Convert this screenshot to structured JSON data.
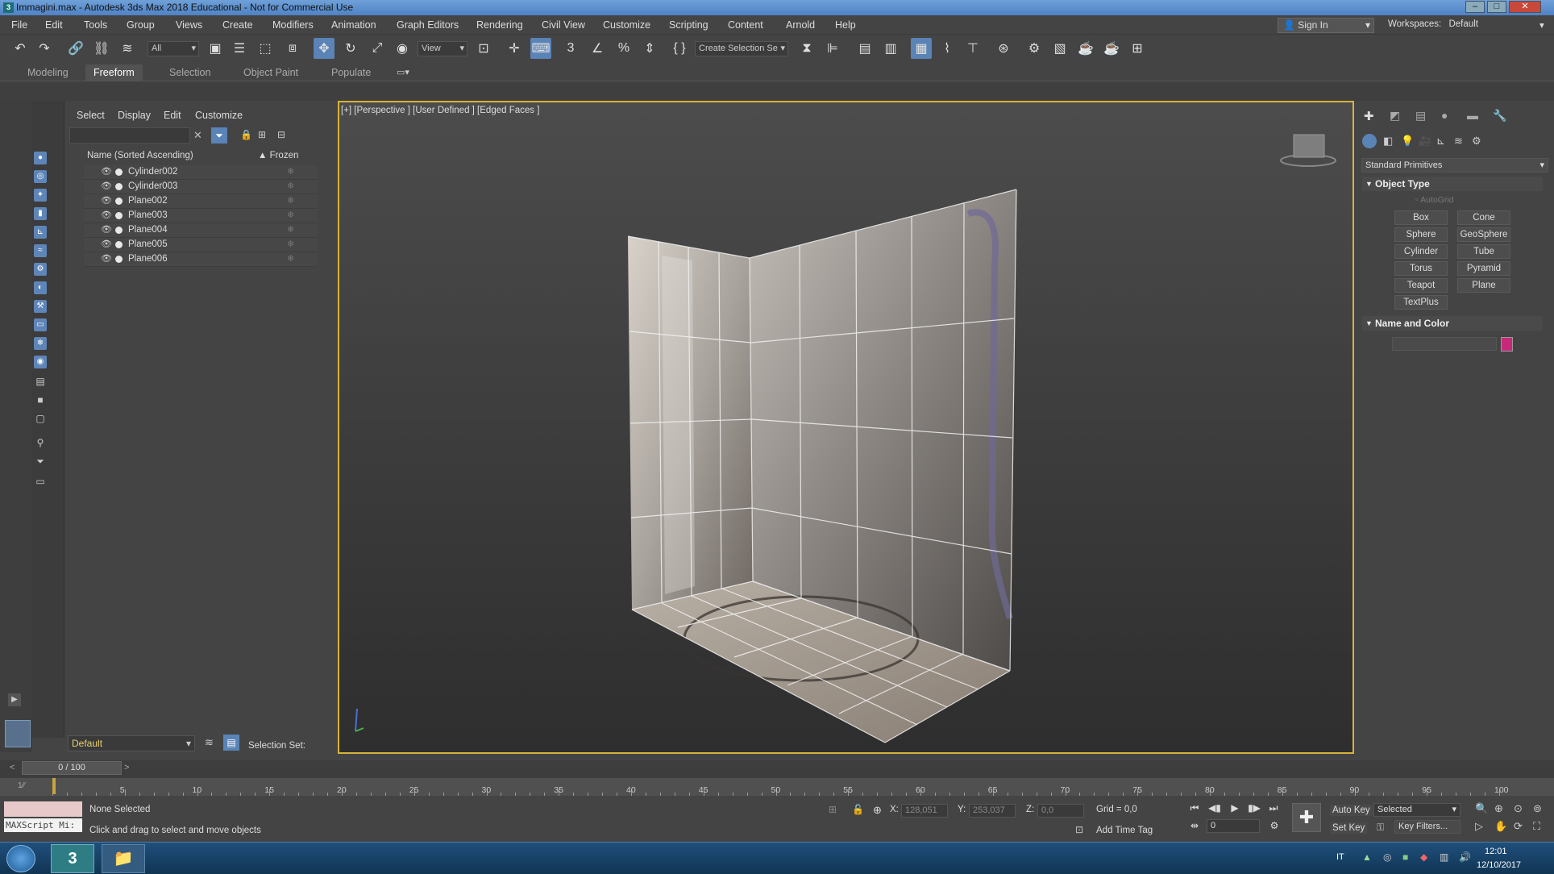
{
  "app": {
    "title": "Immagini.max - Autodesk 3ds Max 2018 Educational - Not for Commercial Use"
  },
  "menu": [
    "File",
    "Edit",
    "Tools",
    "Group",
    "Views",
    "Create",
    "Modifiers",
    "Animation",
    "Graph Editors",
    "Rendering",
    "Civil View",
    "Customize",
    "Scripting",
    "Content",
    "Arnold",
    "Help"
  ],
  "account": {
    "sign_in": "Sign In",
    "workspaces_label": "Workspaces:",
    "workspace": "Default"
  },
  "toolbar": {
    "filter": "All",
    "ref_coord": "View",
    "create_selection_set": "Create Selection Se"
  },
  "ribbon_tabs": [
    "Modeling",
    "Freeform",
    "Selection",
    "Object Paint",
    "Populate"
  ],
  "ribbon_active": "Freeform",
  "scene_explorer": {
    "menu": [
      "Select",
      "Display",
      "Edit",
      "Customize"
    ],
    "col_name": "Name (Sorted Ascending)",
    "col_frozen": "▲ Frozen",
    "objects": [
      "Cylinder002",
      "Cylinder003",
      "Plane002",
      "Plane003",
      "Plane004",
      "Plane005",
      "Plane006"
    ],
    "layer": "Default",
    "selection_set_label": "Selection Set:"
  },
  "viewport": {
    "label": "[+] [Perspective ] [User Defined ] [Edged Faces ]"
  },
  "command_panel": {
    "category": "Standard Primitives",
    "object_type_title": "Object Type",
    "autogrid": "AutoGrid",
    "buttons": [
      "Box",
      "Cone",
      "Sphere",
      "GeoSphere",
      "Cylinder",
      "Tube",
      "Torus",
      "Pyramid",
      "Teapot",
      "Plane",
      "TextPlus"
    ],
    "name_color_title": "Name and Color",
    "object_color": "#c8287a"
  },
  "timeline": {
    "frame_display": "0 / 100",
    "ticks": [
      "5",
      "10",
      "15",
      "20",
      "25",
      "30",
      "35",
      "40",
      "45",
      "50",
      "55",
      "60",
      "65",
      "70",
      "75",
      "80",
      "85",
      "90",
      "95",
      "100"
    ]
  },
  "status": {
    "maxscript": "MAXScript Mi:",
    "selection": "None Selected",
    "prompt": "Click and drag to select and move objects",
    "x_label": "X:",
    "x_value": "128,051",
    "y_label": "Y:",
    "y_value": "253,037",
    "z_label": "Z:",
    "z_value": "0,0",
    "grid": "Grid = 0,0",
    "add_time_tag": "Add Time Tag",
    "auto_key": "Auto Key",
    "set_key": "Set Key",
    "key_mode": "Selected",
    "key_filters": "Key Filters...",
    "frame": "0"
  },
  "taskbar": {
    "lang": "IT",
    "time": "12:01",
    "date": "12/10/2017"
  }
}
